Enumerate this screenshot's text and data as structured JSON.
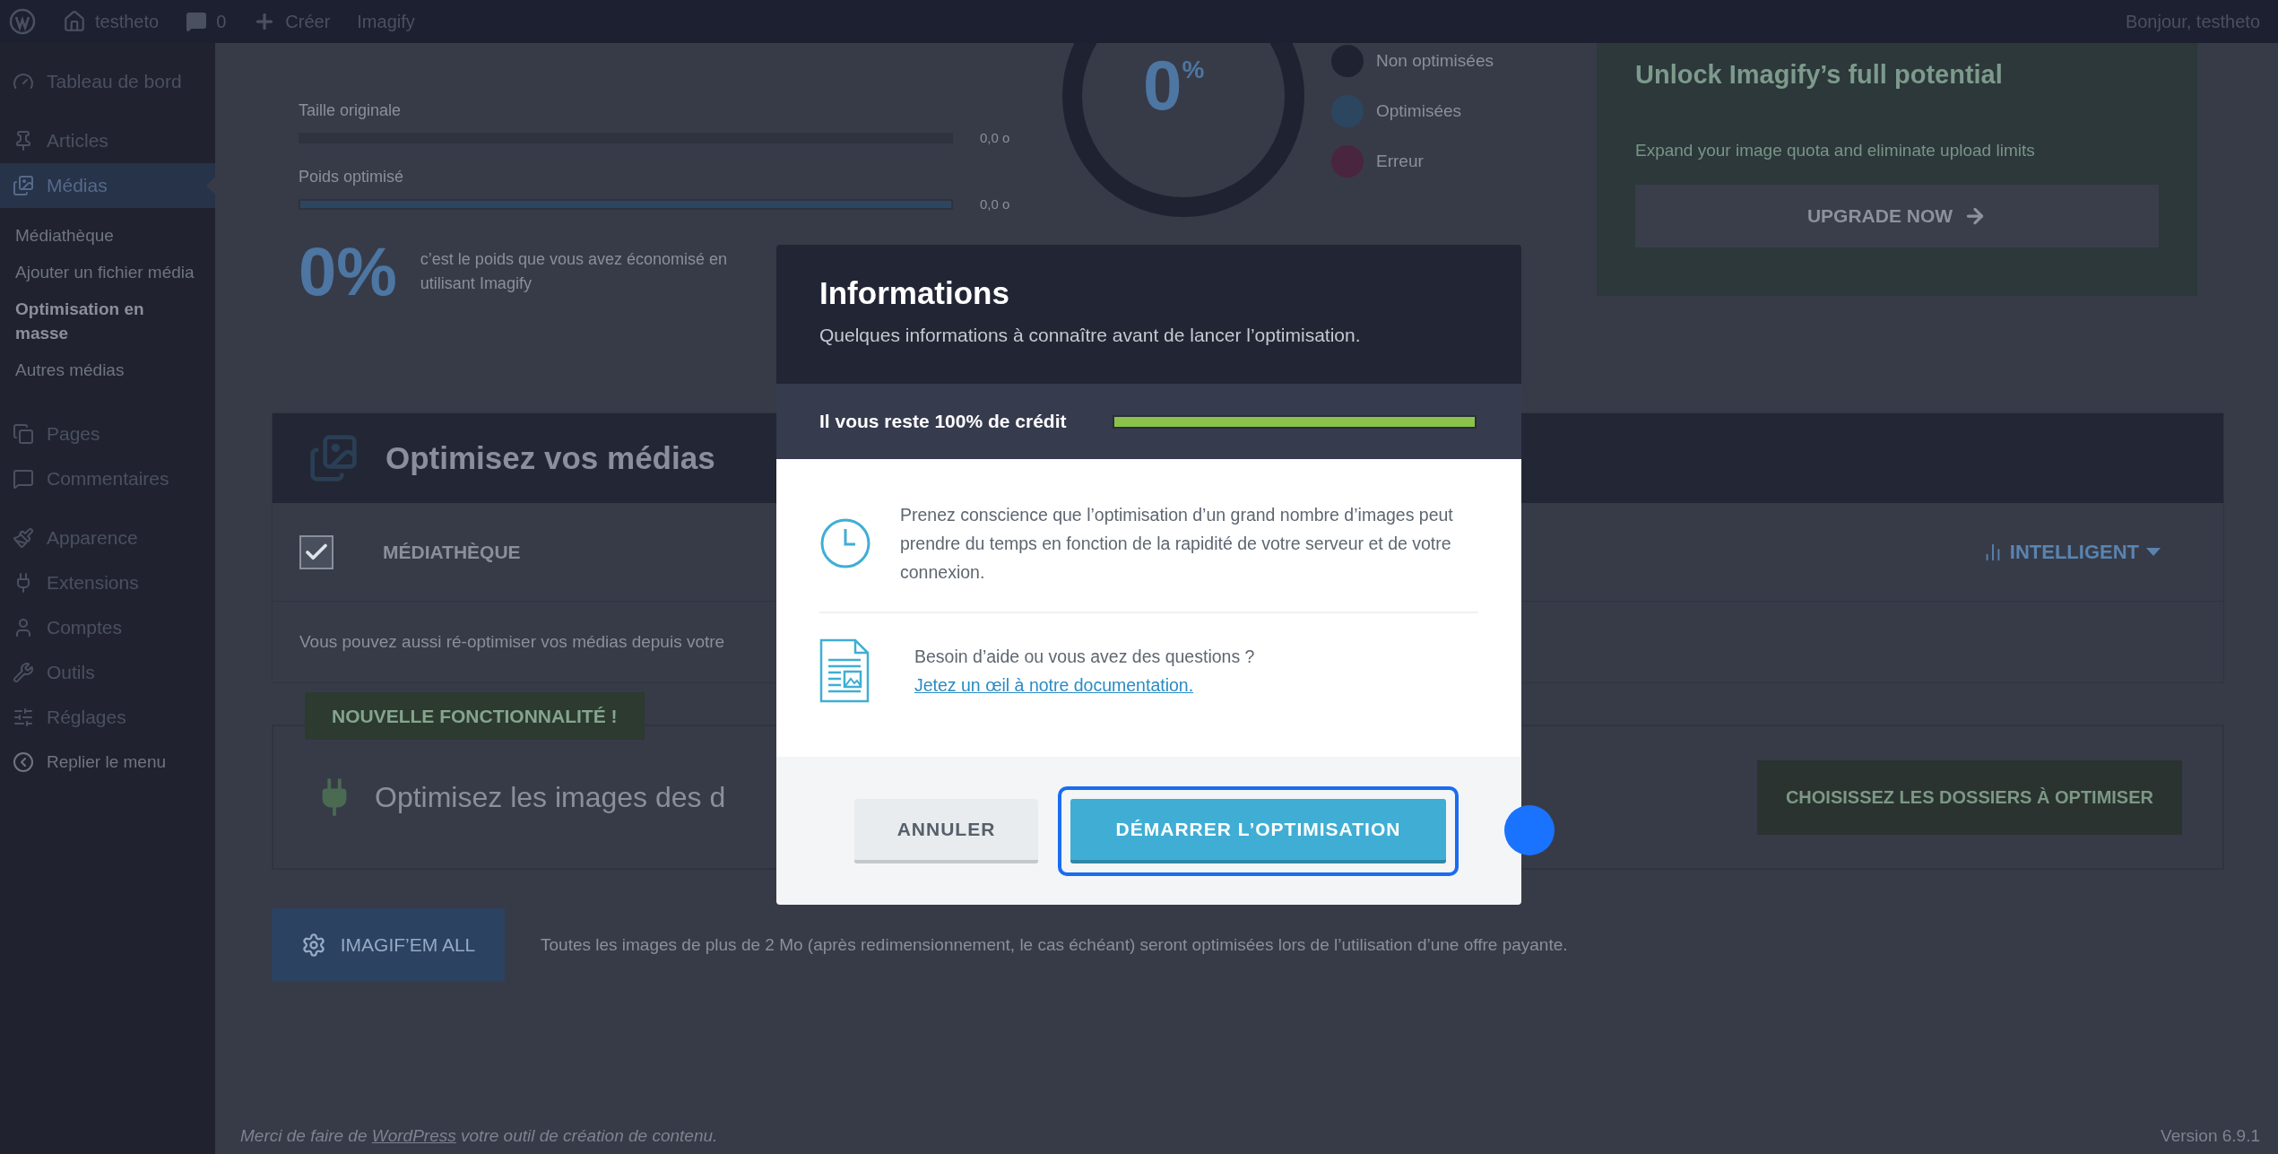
{
  "admin_bar": {
    "site": "testheto",
    "comments": "0",
    "new": "Créer",
    "plugin": "Imagify",
    "greeting": "Bonjour, testheto"
  },
  "sidebar": {
    "items": [
      {
        "label": "Tableau de bord",
        "selected": false
      },
      {
        "label": "Articles",
        "selected": false
      },
      {
        "label": "Médias",
        "selected": true,
        "children": [
          {
            "label": "Médiathèque",
            "selected": false
          },
          {
            "label": "Ajouter un fichier média",
            "selected": false
          },
          {
            "label": "Optimisation en masse",
            "selected": true
          },
          {
            "label": "Autres médias",
            "selected": false
          }
        ]
      },
      {
        "label": "Pages",
        "selected": false
      },
      {
        "label": "Commentaires",
        "selected": false
      },
      {
        "label": "Apparence",
        "selected": false
      },
      {
        "label": "Extensions",
        "selected": false
      },
      {
        "label": "Comptes",
        "selected": false
      },
      {
        "label": "Outils",
        "selected": false
      },
      {
        "label": "Réglages",
        "selected": false
      }
    ],
    "collapse": "Replier le menu"
  },
  "stats": {
    "rows": [
      {
        "label": "Taille originale",
        "value": "0,0 o"
      },
      {
        "label": "Poids optimisé",
        "value": "0,0 o",
        "level": 1
      }
    ],
    "percent": "0%",
    "saved_text": "c’est le poids que vous avez économisé en utilisant Imagify"
  },
  "donut": {
    "value": "0",
    "unit": "%",
    "legend": [
      {
        "label": "Non optimisées",
        "color": "#1f2230"
      },
      {
        "label": "Optimisées",
        "color": "#2d4660"
      },
      {
        "label": "Erreur",
        "color": "#4a2540"
      }
    ]
  },
  "upgrade_card": {
    "title": "Unlock Imagify’s full potential",
    "text": "Expand your image quota and eliminate upload limits",
    "button": "UPGRADE NOW"
  },
  "optimize": {
    "title": "Optimisez vos médias",
    "library": {
      "label": "MÉDIATHÈQUE",
      "checked": true
    },
    "level_select": "INTELLIGENT",
    "note": "Vous pouvez aussi ré-optimiser vos médias depuis votre"
  },
  "new_feature": {
    "badge": "NOUVELLE FONCTIONNALITÉ !",
    "title": "Optimisez les images des d",
    "button": "CHOISISSEZ LES DOSSIERS À OPTIMISER"
  },
  "bulk": {
    "button": "IMAGIF’EM ALL",
    "note": "Toutes les images de plus de 2 Mo (après redimensionnement, le cas échéant) seront optimisées lors de l’utilisation d’une offre payante."
  },
  "footer": {
    "before": "Merci de faire de",
    "link": "WordPress",
    "after": "votre outil de création de contenu.",
    "version": "Version 6.9.1"
  },
  "modal": {
    "title": "Informations",
    "subtitle": "Quelques informations à connaître avant de lancer l’optimisation.",
    "credit": {
      "label": "Il vous reste 100% de crédit",
      "level": 1
    },
    "notices": [
      {
        "kind": "clock",
        "text": "Prenez conscience que l’optimisation d’un grand nombre d’images peut prendre du temps en fonction de la rapidité de votre serveur et de votre connexion."
      },
      {
        "kind": "document",
        "text": "Besoin d’aide ou vous avez des questions ?",
        "link": "Jetez un œil à notre documentation."
      }
    ],
    "buttons": [
      {
        "label": "ANNULER",
        "kind": "secondary"
      },
      {
        "label": "DÉMARRER L’OPTIMISATION",
        "kind": "primary"
      }
    ]
  }
}
